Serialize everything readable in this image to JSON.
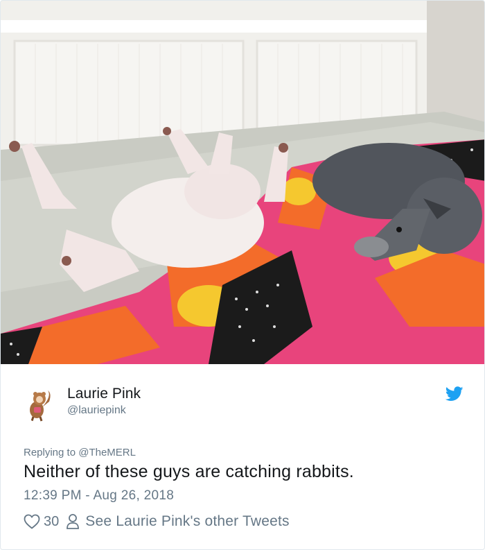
{
  "photo": {
    "description_icon": "photo-icon"
  },
  "author": {
    "display_name": "Laurie Pink",
    "handle": "@lauriepink",
    "avatar_icon": "avatar-illustration-icon"
  },
  "platform_icon": "twitter-bird-icon",
  "reply": {
    "prefix": "Replying to ",
    "mention": "@TheMERL"
  },
  "tweet": {
    "text": "Neither of these guys are catching rabbits.",
    "timestamp": "12:39 PM - Aug 26, 2018"
  },
  "actions": {
    "like_count": "30",
    "see_other_tweets": "See Laurie Pink's other Tweets"
  },
  "colors": {
    "text_primary": "#14171a",
    "text_secondary": "#657786",
    "twitter_blue": "#1da1f2",
    "border": "#e1e8ed"
  }
}
